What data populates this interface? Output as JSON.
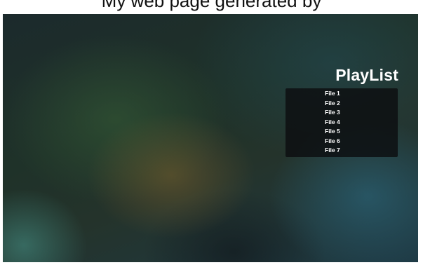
{
  "caption": {
    "text": "My web page generated by"
  },
  "playlist": {
    "title": "PlayList",
    "items": [
      {
        "label": "File 1"
      },
      {
        "label": "File 2"
      },
      {
        "label": "File 3"
      },
      {
        "label": "File 4"
      },
      {
        "label": "File 5"
      },
      {
        "label": "File 6"
      },
      {
        "label": "File 7"
      }
    ]
  }
}
